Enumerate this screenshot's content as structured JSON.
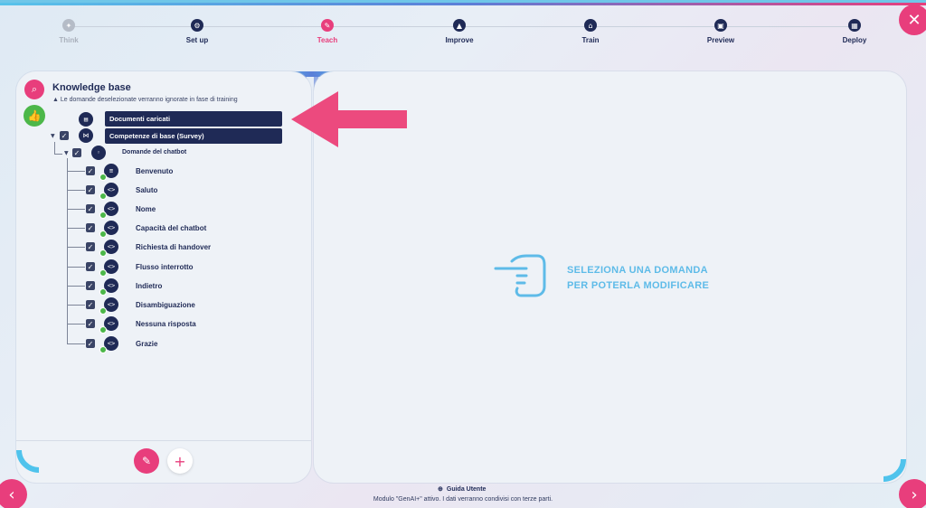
{
  "stepper": {
    "steps": [
      {
        "label": "Think",
        "icon": "bulb-icon",
        "state": "disabled"
      },
      {
        "label": "Set up",
        "icon": "gear-icon",
        "state": "done"
      },
      {
        "label": "Teach",
        "icon": "pencil-icon",
        "state": "active"
      },
      {
        "label": "Improve",
        "icon": "chart-icon",
        "state": "done"
      },
      {
        "label": "Train",
        "icon": "home-icon",
        "state": "done"
      },
      {
        "label": "Preview",
        "icon": "window-icon",
        "state": "done"
      },
      {
        "label": "Deploy",
        "icon": "grid-icon",
        "state": "done"
      }
    ]
  },
  "knowledge_base": {
    "title": "Knowledge base",
    "warning": "Le domande deselezionate verranno ignorate in fase di training",
    "documents_label": "Documenti caricati",
    "survey_label": "Competenze di base (Survey)",
    "group_label": "Domande del chatbot",
    "items": [
      "Benvenuto",
      "Saluto",
      "Nome",
      "Capacità del chatbot",
      "Richiesta di handover",
      "Flusso interrotto",
      "Indietro",
      "Disambiguazione",
      "Nessuna risposta",
      "Grazie"
    ]
  },
  "main": {
    "hint_line1": "SELEZIONA UNA DOMANDA",
    "hint_line2": "PER POTERLA MODIFICARE"
  },
  "footer": {
    "guide_label": "Guida Utente",
    "note": "Modulo \"GenAI+\" attivo. I dati verranno condivisi con terze parti."
  },
  "colors": {
    "accent": "#e83e7c",
    "navy": "#1f2a56",
    "success": "#4cb749",
    "highlight": "#5ebbe8"
  }
}
